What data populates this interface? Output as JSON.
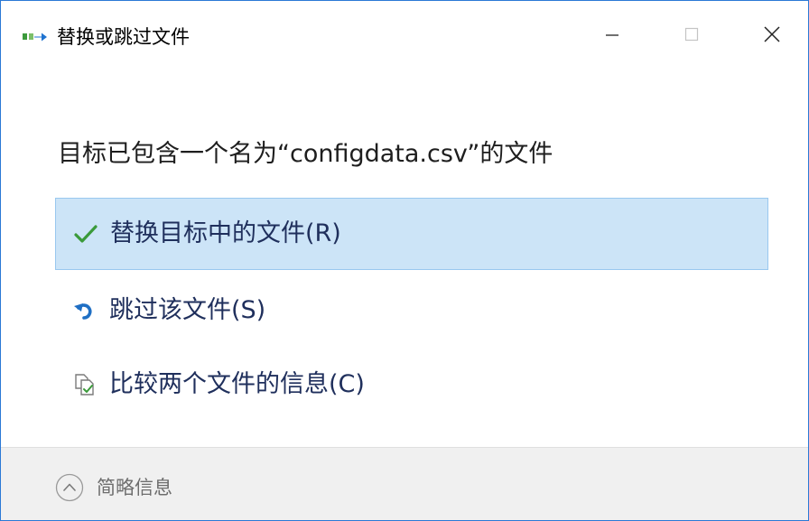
{
  "window": {
    "title": "替换或跳过文件",
    "accent_color": "#2b79d6"
  },
  "content": {
    "heading": "目标已包含一个名为“configdata.csv”的文件",
    "options": [
      {
        "label": "替换目标中的文件(R)",
        "icon": "checkmark-icon",
        "selected": true
      },
      {
        "label": "跳过该文件(S)",
        "icon": "skip-arrow-icon",
        "selected": false
      },
      {
        "label": "比较两个文件的信息(C)",
        "icon": "compare-files-icon",
        "selected": false
      }
    ]
  },
  "footer": {
    "toggle_label": "简略信息",
    "toggle_icon": "chevron-up-circle-icon"
  },
  "colors": {
    "selected_bg": "#cce4f7",
    "selected_border": "#99c8ef",
    "option_text": "#1f2f5c",
    "check_green": "#3a9a3a",
    "skip_blue": "#1f6fc4"
  }
}
